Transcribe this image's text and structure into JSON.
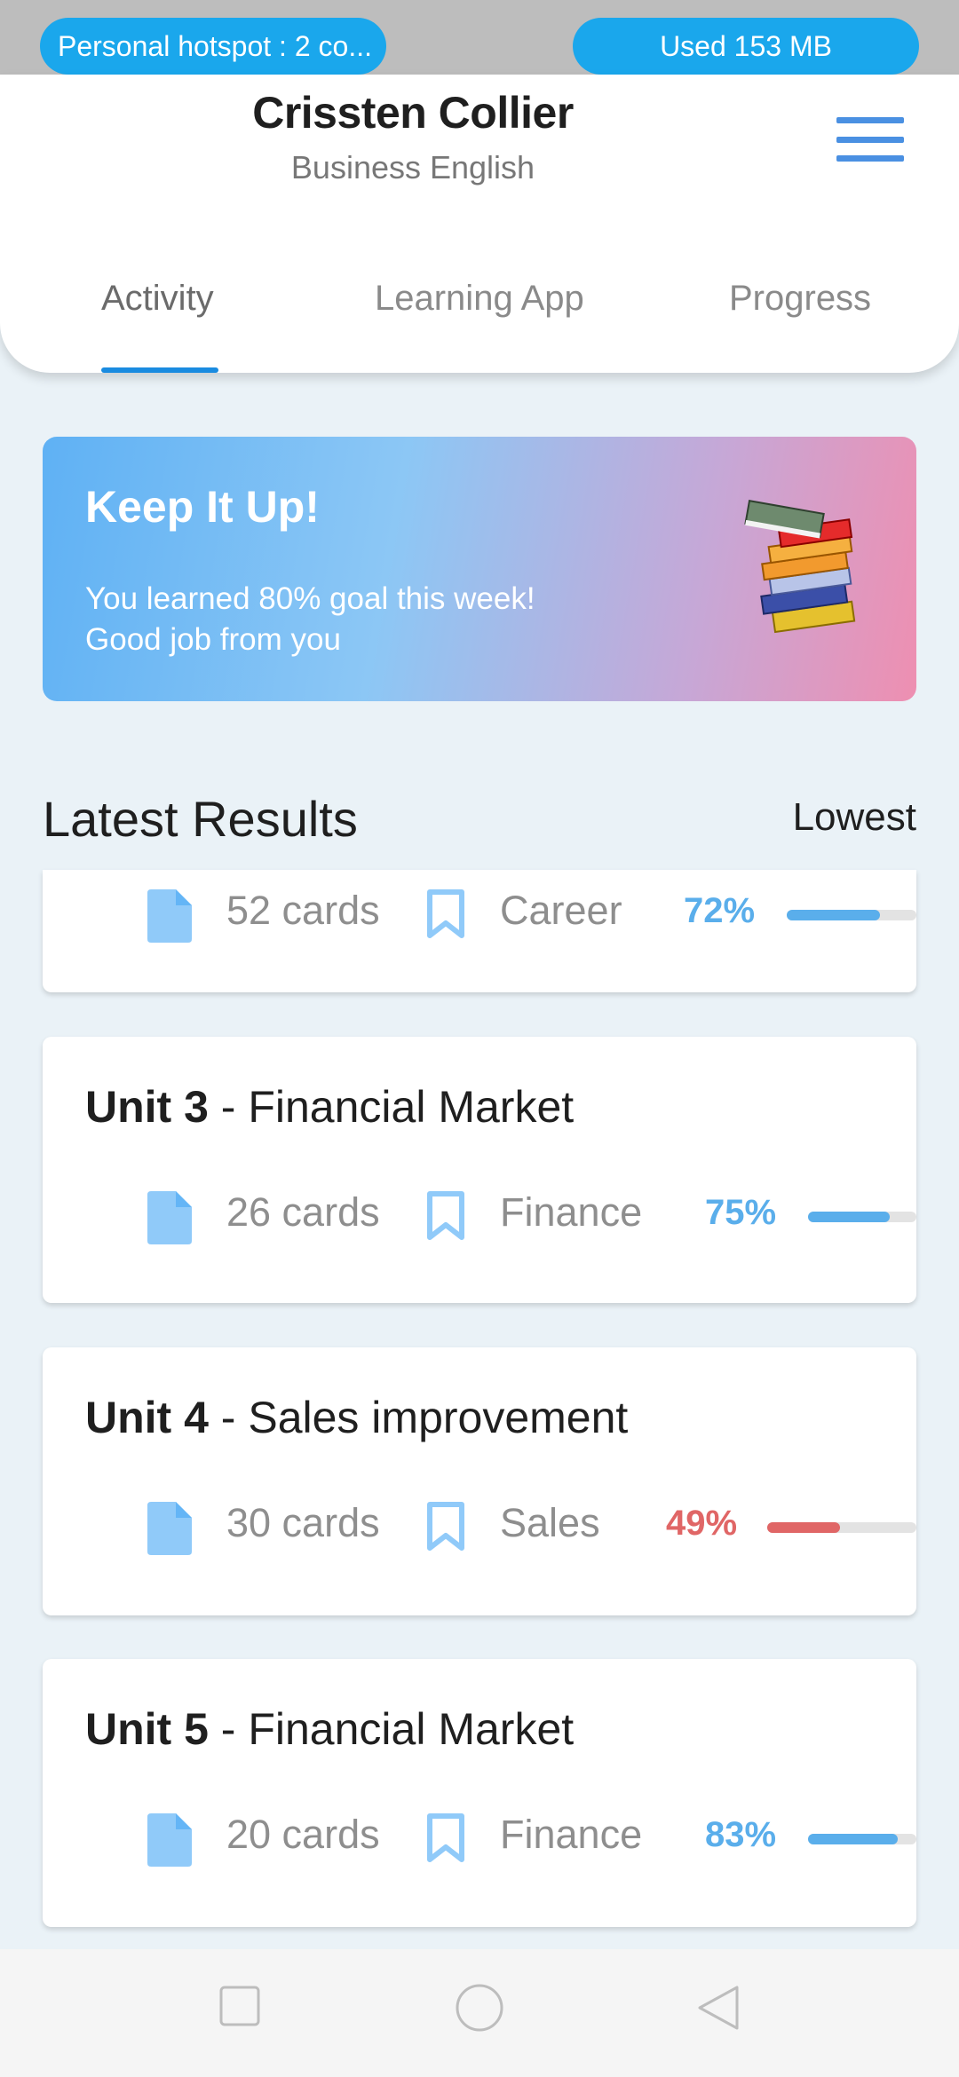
{
  "status_bar": {
    "hotspot": "Personal hotspot : 2 co...",
    "usage": "Used  153 MB"
  },
  "header": {
    "user_name": "Crissten Collier",
    "course": "Business English",
    "tabs": [
      {
        "label": "Activity",
        "active": true
      },
      {
        "label": "Learning App",
        "active": false
      },
      {
        "label": "Progress",
        "active": false
      }
    ]
  },
  "banner": {
    "title": "Keep It Up!",
    "line1": "You learned 80% goal this week!",
    "line2": "Good job from you"
  },
  "results": {
    "title": "Latest Results",
    "sort": "Lowest",
    "items": [
      {
        "unit": "",
        "name": "",
        "cards": "52 cards",
        "tag": "Career",
        "percent": "72%",
        "progress": 0.72,
        "color": "#5AAEEB"
      },
      {
        "unit": "Unit 3",
        "name": " - Financial Market",
        "cards": "26 cards",
        "tag": "Finance",
        "percent": "75%",
        "progress": 0.75,
        "color": "#5AAEEB"
      },
      {
        "unit": "Unit 4",
        "name": " - Sales improvement",
        "cards": "30 cards",
        "tag": "Sales",
        "percent": "49%",
        "progress": 0.49,
        "color": "#E06666"
      },
      {
        "unit": "Unit 5",
        "name": " - Financial Market",
        "cards": "20 cards",
        "tag": "Finance",
        "percent": "83%",
        "progress": 0.83,
        "color": "#5AAEEB"
      }
    ]
  },
  "colors": {
    "accent": "#1A8BE0",
    "icon": "#90CAF9",
    "good": "#5AAEEB",
    "low": "#E06666"
  },
  "nav": {
    "icons": [
      "recent-apps-icon",
      "home-icon",
      "back-icon"
    ]
  }
}
